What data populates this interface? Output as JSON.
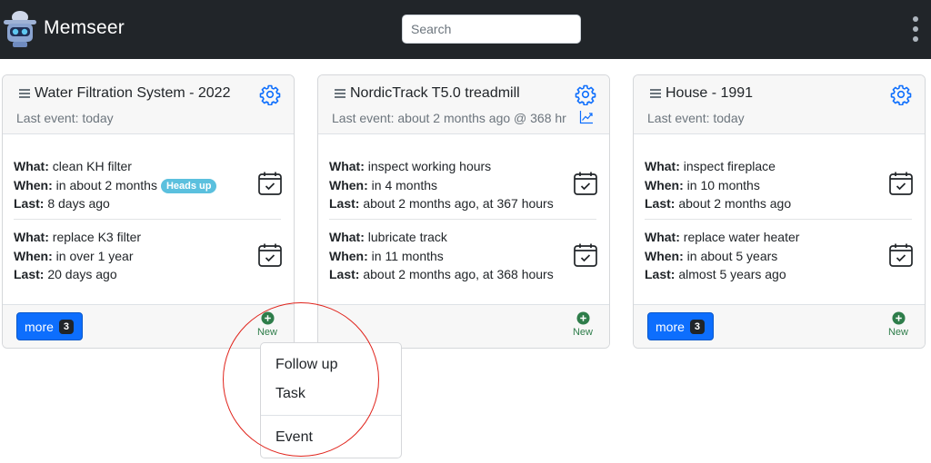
{
  "app": {
    "name": "Memseer"
  },
  "search": {
    "placeholder": "Search"
  },
  "cards": [
    {
      "title": "Water Filtration System - 2022",
      "subtitle": "Last event: today",
      "items": [
        {
          "what_label": "What:",
          "what": "clean KH filter",
          "when_label": "When:",
          "when": "in about 2 months",
          "badge": "Heads up",
          "last_label": "Last:",
          "last": "8 days ago"
        },
        {
          "what_label": "What:",
          "what": "replace K3 filter",
          "when_label": "When:",
          "when": "in over 1 year",
          "last_label": "Last:",
          "last": "20 days ago"
        }
      ],
      "more": {
        "label": "more",
        "count": "3"
      },
      "new_label": "New"
    },
    {
      "title": "NordicTrack T5.0 treadmill",
      "subtitle": "Last event: about 2 months ago @ 368 hr",
      "items": [
        {
          "what_label": "What:",
          "what": "inspect working hours",
          "when_label": "When:",
          "when": "in 4 months",
          "last_label": "Last:",
          "last": "about 2 months ago, at 367 hours"
        },
        {
          "what_label": "What:",
          "what": "lubricate track",
          "when_label": "When:",
          "when": "in 11 months",
          "last_label": "Last:",
          "last": "about 2 months ago, at 368 hours"
        }
      ],
      "new_label": "New"
    },
    {
      "title": "House - 1991",
      "subtitle": "Last event: today",
      "items": [
        {
          "what_label": "What:",
          "what": "inspect fireplace",
          "when_label": "When:",
          "when": "in 10 months",
          "last_label": "Last:",
          "last": "about 2 months ago"
        },
        {
          "what_label": "What:",
          "what": "replace water heater",
          "when_label": "When:",
          "when": "in about 5 years",
          "last_label": "Last:",
          "last": "almost 5 years ago"
        }
      ],
      "more": {
        "label": "more",
        "count": "3"
      },
      "new_label": "New"
    }
  ],
  "new_menu": {
    "items": [
      "Follow up",
      "Task",
      "Event"
    ]
  },
  "colors": {
    "navbar": "#212529",
    "primary": "#0d6efd",
    "badge": "#5bc0de",
    "new_green": "#2e7d4a",
    "highlight": "#e0231b"
  },
  "icons": [
    "robot-logo-icon",
    "kebab-menu-icon",
    "drag-handle-icon",
    "gear-icon",
    "chart-icon",
    "calendar-check-icon",
    "plus-circle-icon"
  ]
}
